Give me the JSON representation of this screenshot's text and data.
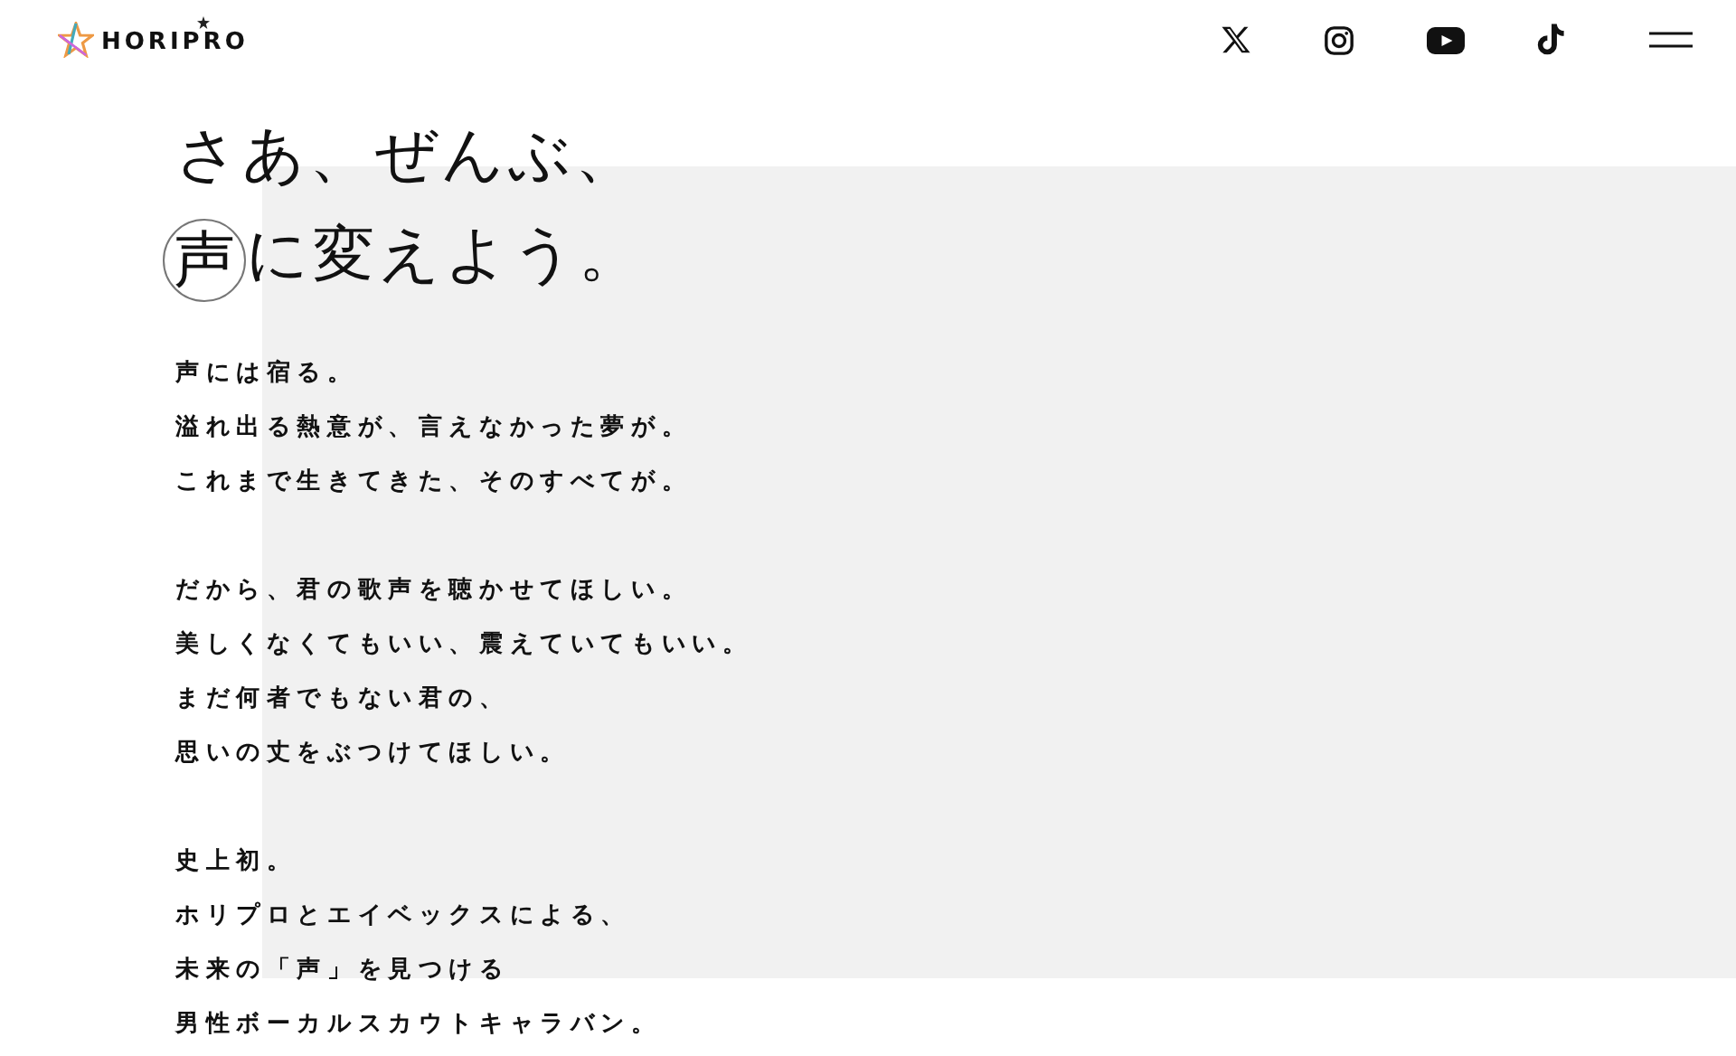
{
  "header": {
    "logo": "HORIPRO",
    "social": [
      {
        "kind": "x"
      },
      {
        "kind": "instagram"
      },
      {
        "kind": "youtube"
      },
      {
        "kind": "tiktok"
      }
    ]
  },
  "headline": [
    [
      {
        "text": "さあ、ぜんぶ、",
        "circled": false
      }
    ],
    [
      {
        "text": "声",
        "circled": true
      },
      {
        "text": "に変えよう。",
        "circled": false
      }
    ]
  ],
  "paragraphs": [
    [
      "声には宿る。",
      "溢れ出る熱意が、言えなかった夢が。",
      "これまで生きてきた、そのすべてが。"
    ],
    [
      "だから、君の歌声を聴かせてほしい。",
      "美しくなくてもいい、震えていてもいい。",
      "まだ何者でもない君の、",
      "思いの丈をぶつけてほしい。"
    ],
    [
      "史上初。",
      "ホリプロとエイベックスによる、",
      "未来の「声」を見つける",
      "男性ボーカルスカウトキャラバン。"
    ]
  ]
}
